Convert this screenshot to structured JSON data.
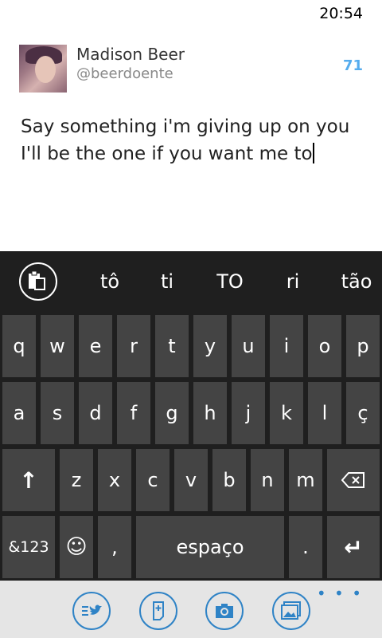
{
  "status": {
    "time": "20:54"
  },
  "profile": {
    "name": "Madison Beer",
    "handle": "@beerdoente",
    "char_count": "71"
  },
  "compose": {
    "lines": [
      "Say something i'm giving up on you",
      "I'll be the one if you want me to"
    ]
  },
  "keyboard": {
    "suggestions": [
      "tô",
      "ti",
      "TO",
      "ri",
      "tão"
    ],
    "row1": [
      "q",
      "w",
      "e",
      "r",
      "t",
      "y",
      "u",
      "i",
      "o",
      "p"
    ],
    "row2": [
      "a",
      "s",
      "d",
      "f",
      "g",
      "h",
      "j",
      "k",
      "l",
      "ç"
    ],
    "row3": [
      "z",
      "x",
      "c",
      "v",
      "b",
      "n",
      "m"
    ],
    "shift_icon": "↑",
    "backspace_icon": "backspace-icon",
    "numbers_label": "&123",
    "emoji_icon": "☺",
    "comma": ",",
    "space_label": "espaço",
    "period": ".",
    "enter_icon": "↵"
  },
  "appbar": {
    "buttons": [
      "tweet-list-icon",
      "add-note-icon",
      "camera-icon",
      "image-icon"
    ],
    "more": "• • •",
    "accent": "#2f83c6"
  }
}
